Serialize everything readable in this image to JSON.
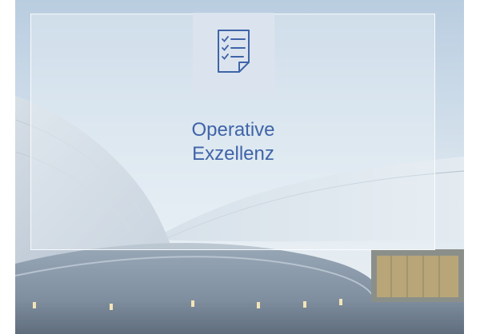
{
  "tile": {
    "icon": "checklist-document-icon",
    "title_line1": "Operative",
    "title_line2": "Exzellenz"
  },
  "colors": {
    "title_text": "#3f64a8",
    "icon_stroke": "#3f64a8",
    "icon_box_bg": "#dbe4ee"
  }
}
